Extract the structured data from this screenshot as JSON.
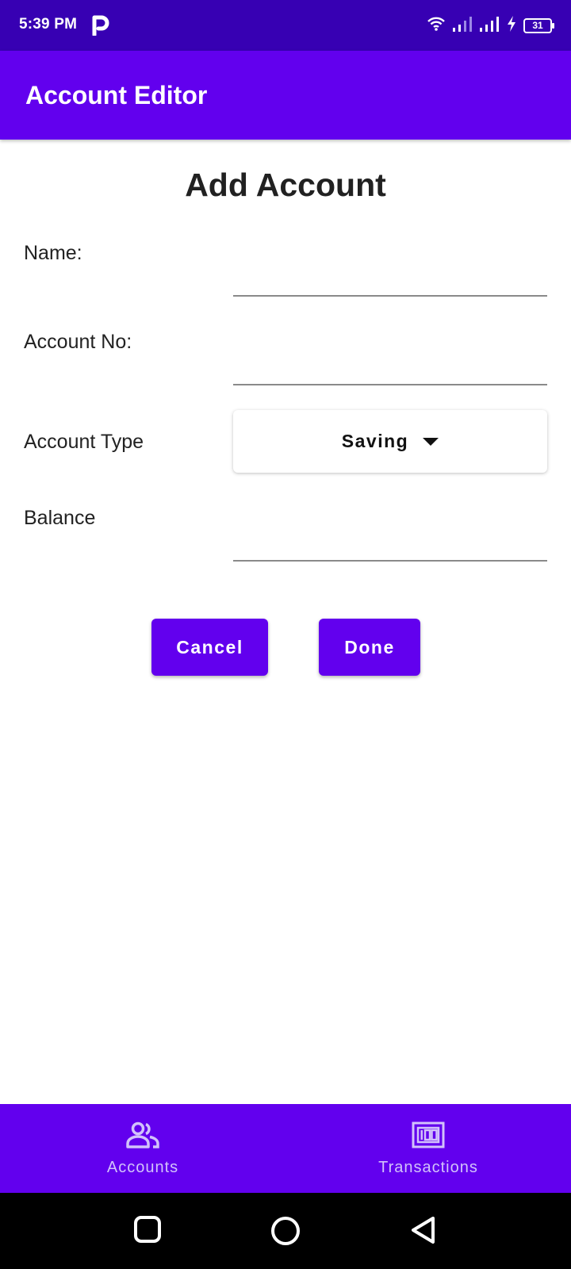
{
  "status_bar": {
    "time": "5:39 PM",
    "app_icon": "p-icon",
    "battery_level": "31",
    "icons": [
      "wifi-icon",
      "signal-icon",
      "signal-icon",
      "charging-icon",
      "battery-icon"
    ]
  },
  "app_bar": {
    "title": "Account Editor"
  },
  "form": {
    "heading": "Add Account",
    "name_label": "Name:",
    "name_value": "",
    "account_no_label": "Account No:",
    "account_no_value": "",
    "account_type_label": "Account Type",
    "account_type_selected": "Saving",
    "balance_label": "Balance",
    "balance_value": ""
  },
  "actions": {
    "cancel_label": "Cancel",
    "done_label": "Done"
  },
  "bottom_nav": {
    "items": [
      {
        "label": "Accounts",
        "icon": "people-icon"
      },
      {
        "label": "Transactions",
        "icon": "money-icon"
      }
    ]
  },
  "system_nav": {
    "icons": [
      "recents-square-icon",
      "home-circle-icon",
      "back-triangle-icon"
    ]
  },
  "colors": {
    "primary": "#6200ee",
    "primary_dark": "#3700b3",
    "on_primary": "#ffffff"
  }
}
